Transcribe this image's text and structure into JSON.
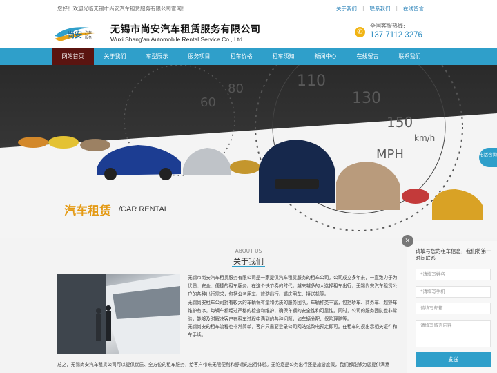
{
  "topbar": {
    "welcome": "您好！欢迎光临无锡市尚安汽车租赁服务有限公司官网！",
    "links": [
      "关于我们",
      "联系我们",
      "在线留言"
    ]
  },
  "header": {
    "logo_text": "尚安汽车服务",
    "company_cn": "无锡市尚安汽车租赁服务有限公司",
    "company_en": "Wuxi Shang'an Automobile Rental Service Co., Ltd.",
    "hotline_label": "全国客服热线:",
    "hotline_number": "137 7112 3276"
  },
  "nav": {
    "items": [
      "网站首页",
      "关于我们",
      "车型展示",
      "服务项目",
      "租车价格",
      "租车须知",
      "新闻中心",
      "在线留言",
      "联系我们"
    ],
    "active_index": 0
  },
  "banner": {
    "tagline_cn": "汽车租赁",
    "tagline_en": "/CAR RENTAL",
    "phone_bubble": "电话咨询"
  },
  "about": {
    "title_en": "ABOUT US",
    "title_cn": "关于我们",
    "paragraphs": [
      "无锡市尚安汽车租赁服务有限公司是一家提供汽车租赁服务的租车公司。公司成立多年来，一直致力于为",
      "优质、安全、便捷的租车服务。在这个快节奏的时代，越来越多的人选择租车出行，无锡尚安汽车租赁公",
      "户的各种出行需求，包括公务用车、旅游出行、婚庆用车、接送机等。",
      "无锡尚安租车公司拥有较大的车辆保有量和优质的服务团队。车辆种类丰富，包括轿车、商务车、越野车",
      "维护有序，每辆车都经过严格的检查和维护，确保车辆的安全性和可靠性。同时，公司的服务团队也非常",
      "验，能够及时解决客户在租车过程中遇到的各种问题，如车辆分配、保险理赔等。",
      "无锡尚安的租车流程也非常简单，客户只需要登录公司网站或致电预定即可。在租车时须出示相关证件和",
      "车手续。"
    ],
    "footer_line": "总之，无锡尚安汽车租赁公司可以提供优质、全方位的租车服务，给客户带来无限便利和舒适的出行体验。无论您是公务出行还是旅游度假，我们都能够为您提供满意"
  },
  "form": {
    "title": "请填写您的租车信息，我们将第一时间联系",
    "fields": [
      "*请填写姓名",
      "*请填写手机",
      "请填写邮箱",
      "请填写留言内容"
    ],
    "submit": "发送"
  }
}
